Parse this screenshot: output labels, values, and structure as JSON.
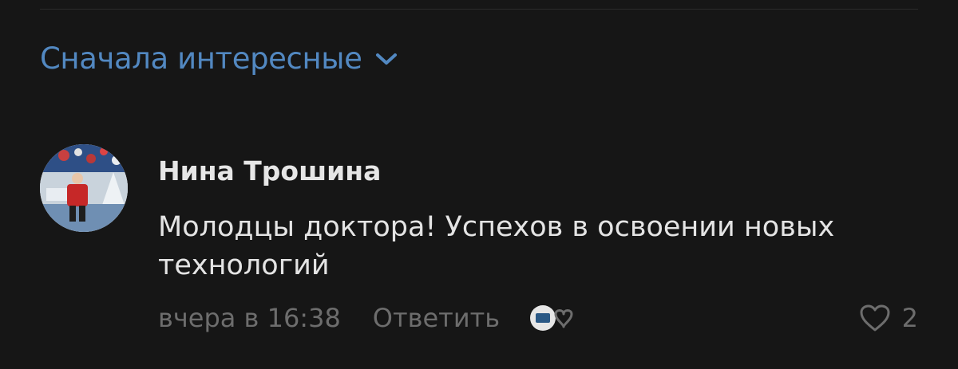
{
  "sort": {
    "label": "Сначала интересные",
    "icon": "chevron-down-icon",
    "color": "#5288c1"
  },
  "comment": {
    "author": "Нина Трошина",
    "text": "Молодцы доктора! Успехов в освоении новых технологий",
    "timestamp": "вчера в 16:38",
    "reply_label": "Ответить",
    "likes_count": "2"
  },
  "icons": {
    "reaction": "reaction-icon",
    "like": "heart-icon"
  }
}
